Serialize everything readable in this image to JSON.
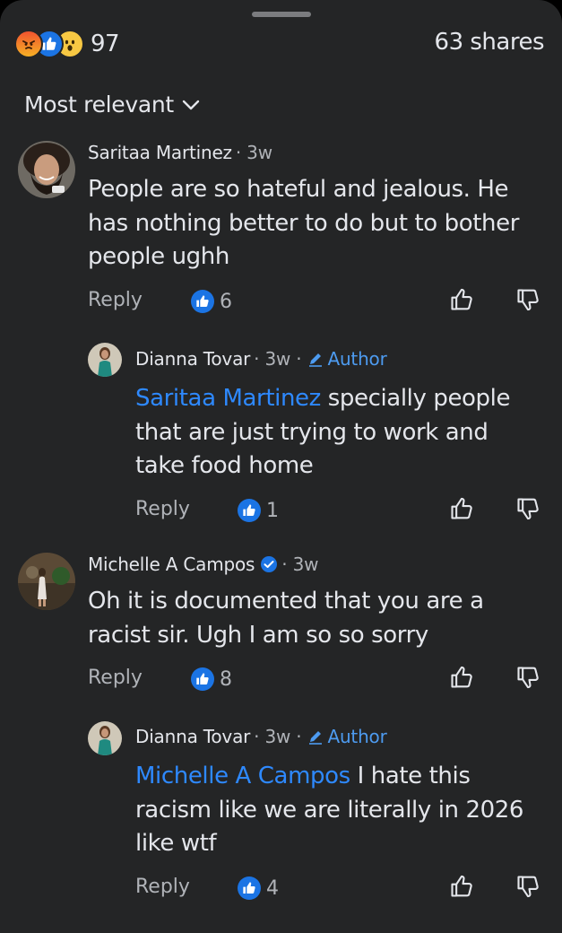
{
  "header": {
    "reaction_icons": [
      "angry-reaction-icon",
      "like-reaction-icon",
      "wow-reaction-icon"
    ],
    "reaction_count": "97",
    "shares": "63 shares"
  },
  "filter": {
    "label": "Most relevant"
  },
  "labels": {
    "reply": "Reply",
    "author": "Author"
  },
  "comments": [
    {
      "name": "Saritaa Martinez",
      "meta": "· 3w",
      "text": "People are so hateful and jealous. He has nothing better to do but to bother people ughh",
      "likes": "6"
    },
    {
      "name": "Dianna Tovar",
      "meta": "· 3w ·",
      "mention": "Saritaa Martinez",
      "text": " specially people that are just trying to work and take food home",
      "likes": "1"
    },
    {
      "name": "Michelle A Campos",
      "meta": "· 3w",
      "text": "Oh it is documented that you are a racist sir. Ugh I am so so sorry",
      "likes": "8"
    },
    {
      "name": "Dianna Tovar",
      "meta": "· 3w ·",
      "mention": "Michelle A Campos",
      "text": " I hate this racism like we are literally in 2026 like wtf",
      "likes": "4"
    }
  ],
  "colors": {
    "background": "#242526",
    "text": "#e4e6eb",
    "muted": "#b0b3b8",
    "link": "#2e89ff",
    "like": "#1b74e4"
  }
}
